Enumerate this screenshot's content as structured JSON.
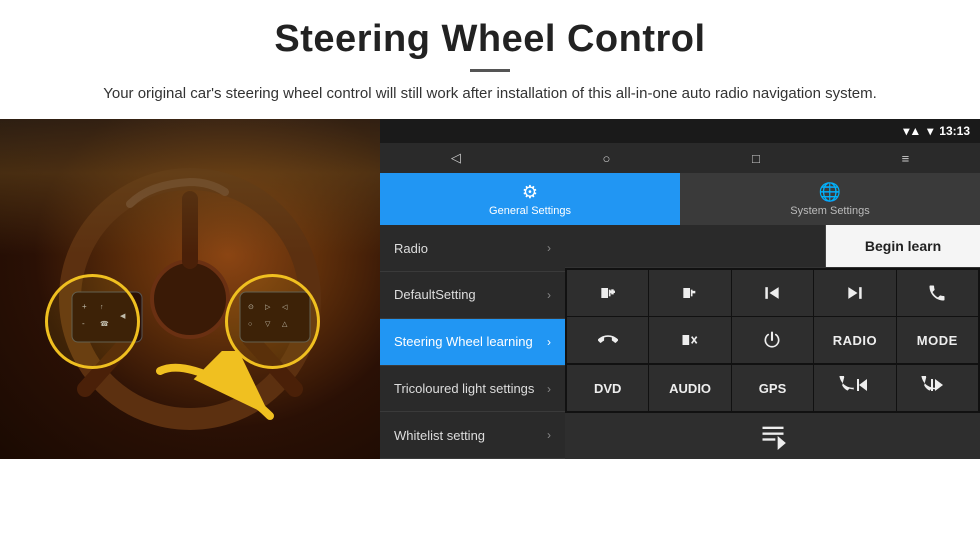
{
  "header": {
    "title": "Steering Wheel Control",
    "divider": true,
    "subtitle": "Your original car's steering wheel control will still work after installation of this all-in-one auto radio navigation system."
  },
  "status_bar": {
    "signal_icon": "▾▴",
    "wifi_icon": "▾",
    "time": "13:13"
  },
  "nav_bar": {
    "back_icon": "◁",
    "home_icon": "○",
    "recent_icon": "□",
    "menu_icon": "≡"
  },
  "tabs": [
    {
      "id": "general",
      "label": "General Settings",
      "icon": "⚙",
      "active": true
    },
    {
      "id": "system",
      "label": "System Settings",
      "icon": "🌐",
      "active": false
    }
  ],
  "menu_items": [
    {
      "id": "radio",
      "label": "Radio",
      "selected": false
    },
    {
      "id": "default",
      "label": "DefaultSetting",
      "selected": false
    },
    {
      "id": "steering",
      "label": "Steering Wheel learning",
      "selected": true
    },
    {
      "id": "tricoloured",
      "label": "Tricoloured light settings",
      "selected": false
    },
    {
      "id": "whitelist",
      "label": "Whitelist setting",
      "selected": false
    }
  ],
  "buttons": {
    "begin_learn": "Begin learn",
    "grid": [
      {
        "id": "vol_up",
        "type": "icon",
        "label": "▶|+"
      },
      {
        "id": "vol_down",
        "type": "icon",
        "label": "◀|-"
      },
      {
        "id": "prev_track",
        "type": "icon",
        "label": "|◀◀"
      },
      {
        "id": "next_track",
        "type": "icon",
        "label": "▶▶|"
      },
      {
        "id": "phone",
        "type": "icon",
        "label": "☎"
      },
      {
        "id": "hook",
        "type": "icon",
        "label": "↩"
      },
      {
        "id": "mute",
        "type": "icon",
        "label": "◀|✕"
      },
      {
        "id": "power",
        "type": "icon",
        "label": "⏻"
      },
      {
        "id": "radio_btn",
        "type": "text",
        "label": "RADIO"
      },
      {
        "id": "mode_btn",
        "type": "text",
        "label": "MODE"
      },
      {
        "id": "dvd_btn",
        "type": "text",
        "label": "DVD"
      },
      {
        "id": "audio_btn",
        "type": "text",
        "label": "AUDIO"
      },
      {
        "id": "gps_btn",
        "type": "text",
        "label": "GPS"
      },
      {
        "id": "phone_prev",
        "type": "icon",
        "label": "☎◀◀"
      },
      {
        "id": "phone_next",
        "type": "icon",
        "label": "☎▶▶"
      }
    ],
    "last_icon": "☰"
  },
  "colors": {
    "accent_blue": "#2196F3",
    "dark_bg": "#1a1a1a",
    "panel_bg": "#2a2a2a",
    "text_light": "#eeeeee",
    "selected_menu": "#2196F3"
  }
}
